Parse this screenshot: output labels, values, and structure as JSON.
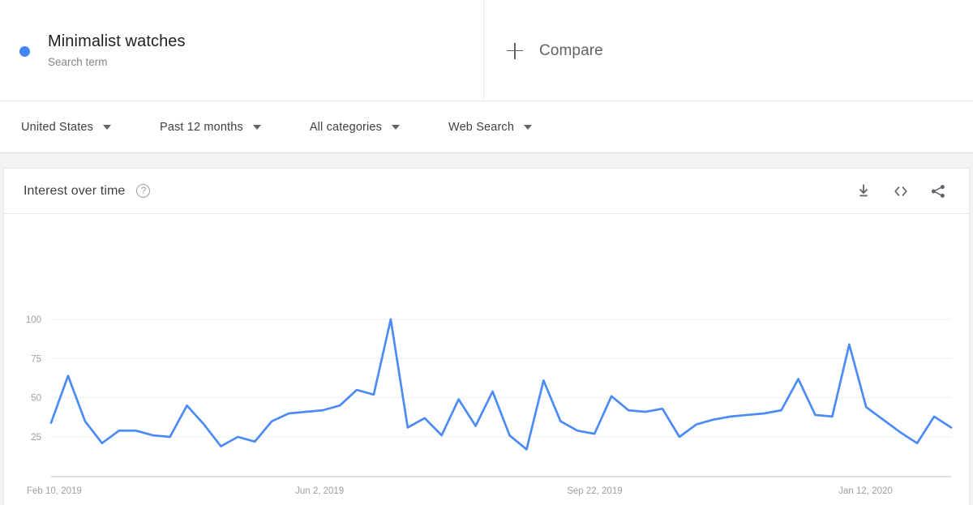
{
  "terms": [
    {
      "label": "Minimalist watches",
      "sublabel": "Search term",
      "color": "#4285f4",
      "dot_name": "series-dot"
    }
  ],
  "compare": {
    "label": "Compare",
    "icon": "plus-icon"
  },
  "filters": [
    {
      "label": "United States",
      "name": "filter-location"
    },
    {
      "label": "Past 12 months",
      "name": "filter-time-range"
    },
    {
      "label": "All categories",
      "name": "filter-category"
    },
    {
      "label": "Web Search",
      "name": "filter-search-type"
    }
  ],
  "chart_card": {
    "title": "Interest over time",
    "help_glyph": "?",
    "actions": [
      {
        "name": "download-icon"
      },
      {
        "name": "embed-code-icon"
      },
      {
        "name": "share-icon"
      }
    ]
  },
  "chart_data": {
    "type": "line",
    "title": "Interest over time",
    "xlabel": "",
    "ylabel": "",
    "ylim": [
      0,
      100
    ],
    "grid": true,
    "legend_position": "top",
    "yticks": [
      100,
      75,
      50,
      25
    ],
    "xticks": [
      "Feb 10, 2019",
      "Jun 2, 2019",
      "Sep 22, 2019",
      "Jan 12, 2020"
    ],
    "xtick_indices": [
      0,
      16,
      32,
      48
    ],
    "line_color": "#4c8bf5",
    "series": [
      {
        "name": "Minimalist watches",
        "color": "#4c8bf5",
        "values": [
          34,
          64,
          35,
          21,
          29,
          29,
          26,
          25,
          45,
          33,
          19,
          25,
          22,
          35,
          40,
          41,
          42,
          45,
          55,
          52,
          100,
          31,
          37,
          26,
          49,
          32,
          54,
          26,
          17,
          61,
          35,
          29,
          27,
          51,
          42,
          41,
          43,
          25,
          33,
          36,
          38,
          39,
          40,
          42,
          62,
          39,
          38,
          84,
          44,
          36,
          28,
          21,
          38,
          31
        ]
      }
    ]
  }
}
